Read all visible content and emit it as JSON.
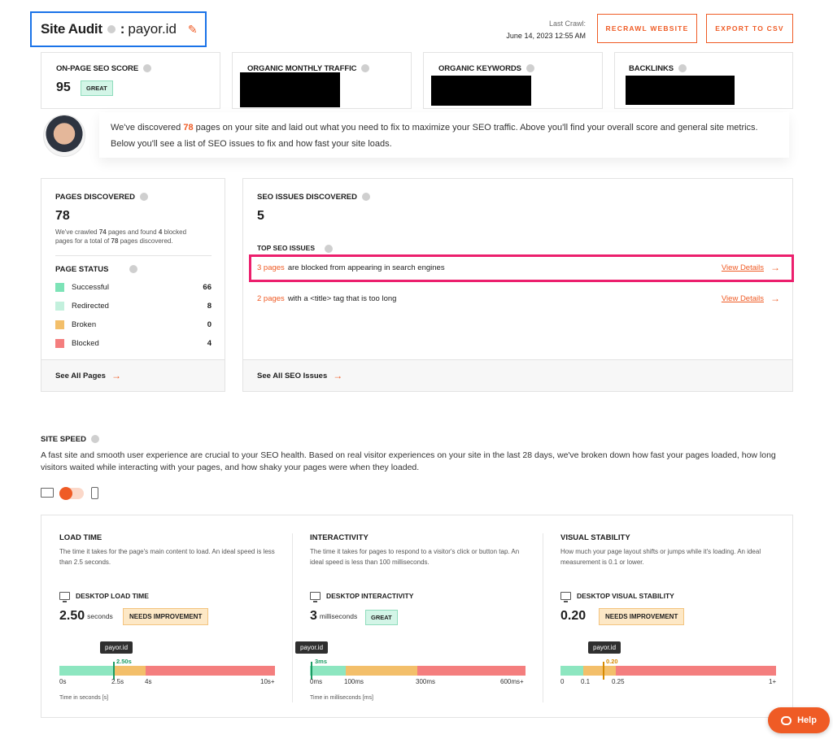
{
  "header": {
    "title": "Site Audit",
    "separator": ":",
    "domain": "payor.id",
    "last_crawl_label": "Last Crawl:",
    "last_crawl_value": "June 14, 2023 12:55 AM",
    "recrawl_label": "RECRAWL WEBSITE",
    "export_label": "EXPORT TO CSV"
  },
  "metrics": {
    "seo_score_label": "ON-PAGE SEO SCORE",
    "seo_score_value": "95",
    "seo_score_badge": "GREAT",
    "traffic_label": "ORGANIC MONTHLY TRAFFIC",
    "keywords_label": "ORGANIC KEYWORDS",
    "backlinks_label": "BACKLINKS"
  },
  "banner": {
    "text_before": "We've discovered ",
    "pages_count": "78",
    "text_after": " pages on your site and laid out what you need to fix to maximize your SEO traffic. Above you'll find your overall score and general site metrics. Below you'll see a list of SEO issues to fix and how fast your site loads."
  },
  "pages_panel": {
    "title": "PAGES DISCOVERED",
    "count": "78",
    "desc_1": "We've crawled ",
    "desc_crawled": "74",
    "desc_2": " pages and found ",
    "desc_blocked": "4",
    "desc_3": " blocked pages for a total of ",
    "desc_total": "78",
    "desc_4": " pages discovered.",
    "status_title": "PAGE STATUS",
    "statuses": [
      {
        "label": "Successful",
        "count": "66",
        "color": "#7de3b7"
      },
      {
        "label": "Redirected",
        "count": "8",
        "color": "#c3f0dd"
      },
      {
        "label": "Broken",
        "count": "0",
        "color": "#f3bf6a"
      },
      {
        "label": "Blocked",
        "count": "4",
        "color": "#f47e7e"
      }
    ],
    "footer_link": "See All Pages"
  },
  "issues_panel": {
    "title": "SEO ISSUES DISCOVERED",
    "count": "5",
    "top_title": "TOP SEO ISSUES",
    "issues": [
      {
        "link": "3 pages",
        "text": "are blocked from appearing in search engines",
        "action": "View Details"
      },
      {
        "link": "2 pages",
        "text": "with a <title> tag that is too long",
        "action": "View Details"
      }
    ],
    "footer_link": "See All SEO Issues"
  },
  "site_speed": {
    "title": "SITE SPEED",
    "description": "A fast site and smooth user experience are crucial to your SEO health. Based on real visitor experiences on your site in the last 28 days, we've broken down how fast your pages loaded, how long visitors waited while interacting with your pages, and how shaky your pages were when they loaded.",
    "columns": [
      {
        "title": "LOAD TIME",
        "desc": "The time it takes for the page's main content to load. An ideal speed is less than 2.5 seconds.",
        "sub_title": "DESKTOP LOAD TIME",
        "value": "2.50",
        "unit": "seconds",
        "badge": "NEEDS IMPROVEMENT",
        "tooltip": "payor.id",
        "marker_label": "2.50s",
        "ticks": [
          "0s",
          "2.5s",
          "4s",
          "10s+"
        ],
        "axis_caption": "Time in seconds [s]"
      },
      {
        "title": "INTERACTIVITY",
        "desc": "The time it takes for pages to respond to a visitor's click or button tap. An ideal speed is less than 100 milliseconds.",
        "sub_title": "DESKTOP INTERACTIVITY",
        "value": "3",
        "unit": "milliseconds",
        "badge": "GREAT",
        "tooltip": "payor.id",
        "marker_label": "3ms",
        "ticks": [
          "0ms",
          "100ms",
          "300ms",
          "600ms+"
        ],
        "axis_caption": "Time in milliseconds [ms]"
      },
      {
        "title": "VISUAL STABILITY",
        "desc": "How much your page layout shifts or jumps while it's loading. An ideal measurement is 0.1 or lower.",
        "sub_title": "DESKTOP VISUAL STABILITY",
        "value": "0.20",
        "unit": "",
        "badge": "NEEDS IMPROVEMENT",
        "tooltip": "payor.id",
        "marker_label": "0.20",
        "ticks": [
          "0",
          "0.1",
          "0.25",
          "1+"
        ],
        "axis_caption": ""
      }
    ]
  },
  "help_label": "Help",
  "colors": {
    "accent": "#ef5b25",
    "highlight": "#ec1f6d",
    "title_box": "#1a73e8"
  }
}
